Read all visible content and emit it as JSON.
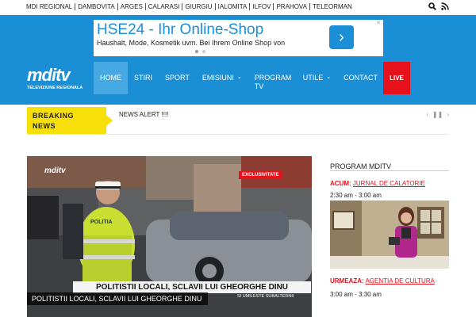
{
  "regions": [
    "MDI REGIONAL",
    "DAMBOVITA",
    "ARGES",
    "CALARASI",
    "GIURGIU",
    "IALOMITA",
    "ILFOV",
    "PRAHOVA",
    "TELEORMAN"
  ],
  "ad": {
    "title": "HSE24 - Ihr Online-Shop",
    "desc": "Haushalt, Mode, Kosmetik uvm. Bei Ihrem Online Shop von",
    "arrow": "›",
    "close": "✕"
  },
  "logo": {
    "text": "mditv",
    "sub": "TELEVIZIUNE REGIONALA"
  },
  "nav": {
    "home": "HOME",
    "stiri": "STIRI",
    "sport": "SPORT",
    "emisiuni": "EMISIUNI",
    "program_1": "PROGRAM",
    "program_2": "TV",
    "utile": "UTILE",
    "contact": "CONTACT",
    "live": "LIVE",
    "chevron": "⌄"
  },
  "breaking": {
    "label_1": "BREAKING",
    "label_2": "NEWS",
    "alert": "NEWS ALERT !!!!",
    "prev": "‹",
    "pause": "❚❚",
    "next": "›"
  },
  "photo": {
    "caption": "POLITISTII LOCALI, SCLAVII LUI GHEORGHE DINU",
    "badge": "EXCLUSIVITATE",
    "logo": "mditv",
    "lower_third": "POLITISTII LOCALI, SCLAVII LUI GHEORGHE DINU",
    "lower_sub": "SI UMILESTE SUBALTERNII",
    "police": "POLITIA"
  },
  "program": {
    "title": "PROGRAM MDITV",
    "now_label": "ACUM:",
    "now_show": "JURNAL DE CALATORIE",
    "now_time": "2:30 am - 3:00 am",
    "next_label": "URMEAZA:",
    "next_show": "AGENTIA DE CULTURA",
    "next_time": "3:00 am - 3:30 am"
  },
  "colors": {
    "brand_blue": "#1a8fd6",
    "live_red": "#e6111b",
    "breaking_yellow": "#f7df0a"
  }
}
